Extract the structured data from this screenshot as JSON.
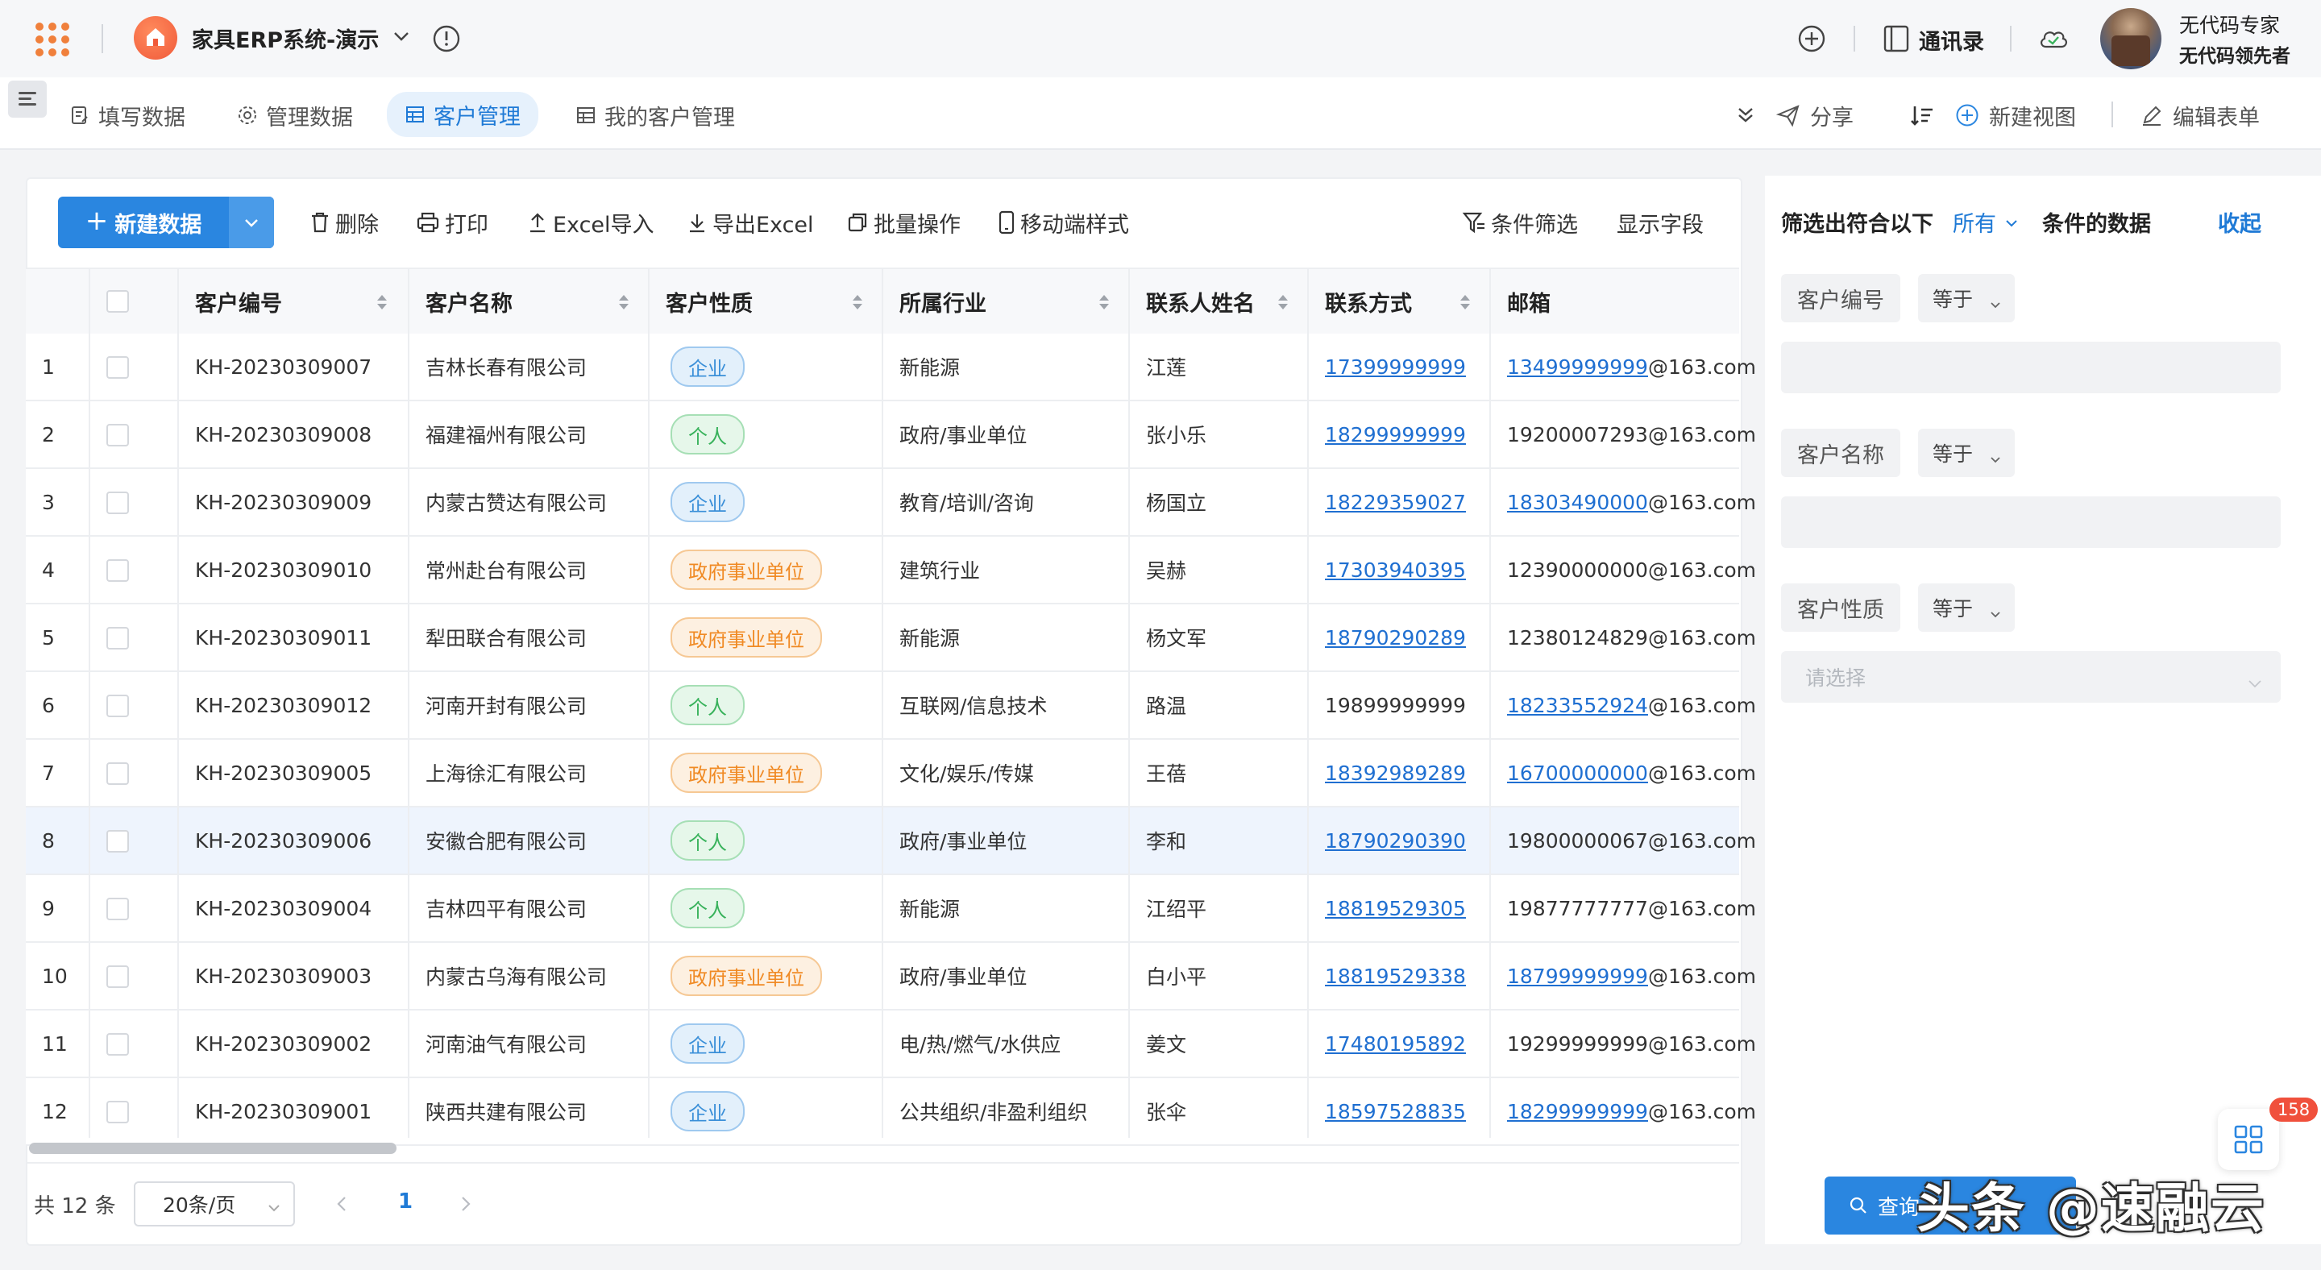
{
  "app": {
    "title": "家具ERP系统-演示"
  },
  "top_right": {
    "contacts": "通讯录"
  },
  "user": {
    "line1": "无代码专家",
    "line2": "无代码领先者"
  },
  "tabs": [
    {
      "label": "填写数据",
      "icon": "form-icon"
    },
    {
      "label": "管理数据",
      "icon": "gear-icon"
    },
    {
      "label": "客户管理",
      "icon": "table-icon",
      "active": true
    },
    {
      "label": "我的客户管理",
      "icon": "table-icon"
    }
  ],
  "right_tools": {
    "share": "分享",
    "new_view": "新建视图",
    "edit_form": "编辑表单"
  },
  "toolbar": {
    "new_data": "新建数据",
    "delete": "删除",
    "print": "打印",
    "excel_import": "Excel导入",
    "export_excel": "导出Excel",
    "batch": "批量操作",
    "mobile": "移动端样式",
    "filter": "条件筛选",
    "fields": "显示字段"
  },
  "table": {
    "columns": [
      "客户编号",
      "客户名称",
      "客户性质",
      "所属行业",
      "联系人姓名",
      "联系方式",
      "邮箱"
    ],
    "rows": [
      {
        "idx": "1",
        "code": "KH-20230309007",
        "name": "吉林长春有限公司",
        "type": "企业",
        "industry": "新能源",
        "contact": "江莲",
        "phone": "17399999999",
        "phone_link": true,
        "email_prefix": "13499999999",
        "email_suffix": "@163.com",
        "email_link": true
      },
      {
        "idx": "2",
        "code": "KH-20230309008",
        "name": "福建福州有限公司",
        "type": "个人",
        "industry": "政府/事业单位",
        "contact": "张小乐",
        "phone": "18299999999",
        "phone_link": true,
        "email_prefix": "19200007293",
        "email_suffix": "@163.com",
        "email_link": false
      },
      {
        "idx": "3",
        "code": "KH-20230309009",
        "name": "内蒙古赞达有限公司",
        "type": "企业",
        "industry": "教育/培训/咨询",
        "contact": "杨国立",
        "phone": "18229359027",
        "phone_link": true,
        "email_prefix": "18303490000",
        "email_suffix": "@163.com",
        "email_link": true
      },
      {
        "idx": "4",
        "code": "KH-20230309010",
        "name": "常州赴台有限公司",
        "type": "政府事业单位",
        "industry": "建筑行业",
        "contact": "吴赫",
        "phone": "17303940395",
        "phone_link": true,
        "email_prefix": "12390000000",
        "email_suffix": "@163.com",
        "email_link": false
      },
      {
        "idx": "5",
        "code": "KH-20230309011",
        "name": "犁田联合有限公司",
        "type": "政府事业单位",
        "industry": "新能源",
        "contact": "杨文军",
        "phone": "18790290289",
        "phone_link": true,
        "email_prefix": "12380124829",
        "email_suffix": "@163.com",
        "email_link": false
      },
      {
        "idx": "6",
        "code": "KH-20230309012",
        "name": "河南开封有限公司",
        "type": "个人",
        "industry": "互联网/信息技术",
        "contact": "路温",
        "phone": "19899999999",
        "phone_link": false,
        "email_prefix": "18233552924",
        "email_suffix": "@163.com",
        "email_link": true
      },
      {
        "idx": "7",
        "code": "KH-20230309005",
        "name": "上海徐汇有限公司",
        "type": "政府事业单位",
        "industry": "文化/娱乐/传媒",
        "contact": "王蓓",
        "phone": "18392989289",
        "phone_link": true,
        "email_prefix": "16700000000",
        "email_suffix": "@163.com",
        "email_link": true
      },
      {
        "idx": "8",
        "code": "KH-20230309006",
        "name": "安徽合肥有限公司",
        "type": "个人",
        "industry": "政府/事业单位",
        "contact": "李和",
        "phone": "18790290390",
        "phone_link": true,
        "email_prefix": "19800000067",
        "email_suffix": "@163.com",
        "email_link": false,
        "highlight": true
      },
      {
        "idx": "9",
        "code": "KH-20230309004",
        "name": "吉林四平有限公司",
        "type": "个人",
        "industry": "新能源",
        "contact": "江绍平",
        "phone": "18819529305",
        "phone_link": true,
        "email_prefix": "19877777777",
        "email_suffix": "@163.com",
        "email_link": false
      },
      {
        "idx": "10",
        "code": "KH-20230309003",
        "name": "内蒙古乌海有限公司",
        "type": "政府事业单位",
        "industry": "政府/事业单位",
        "contact": "白小平",
        "phone": "18819529338",
        "phone_link": true,
        "email_prefix": "18799999999",
        "email_suffix": "@163.com",
        "email_link": true
      },
      {
        "idx": "11",
        "code": "KH-20230309002",
        "name": "河南油气有限公司",
        "type": "企业",
        "industry": "电/热/燃气/水供应",
        "contact": "姜文",
        "phone": "17480195892",
        "phone_link": true,
        "email_prefix": "19299999999",
        "email_suffix": "@163.com",
        "email_link": false
      },
      {
        "idx": "12",
        "code": "KH-20230309001",
        "name": "陕西共建有限公司",
        "type": "企业",
        "industry": "公共组织/非盈利组织",
        "contact": "张伞",
        "phone": "18597528835",
        "phone_link": true,
        "email_prefix": "18299999999",
        "email_suffix": "@163.com",
        "email_link": true
      }
    ]
  },
  "pagination": {
    "total": "共 12 条",
    "page_size": "20条/页",
    "current": "1"
  },
  "filter": {
    "title": "筛选出符合以下",
    "scope": "所有",
    "suffix": "条件的数据",
    "collapse": "收起",
    "fields": [
      {
        "label": "客户编号",
        "op": "等于"
      },
      {
        "label": "客户名称",
        "op": "等于"
      },
      {
        "label": "客户性质",
        "op": "等于"
      }
    ],
    "select_placeholder": "请选择",
    "query_btn": "查询"
  },
  "float_badge": "158",
  "watermark": "头条 @速融云",
  "colors": {
    "primary": "#2a86e0",
    "link": "#1f6fd1",
    "badge_red": "#f0503c"
  }
}
